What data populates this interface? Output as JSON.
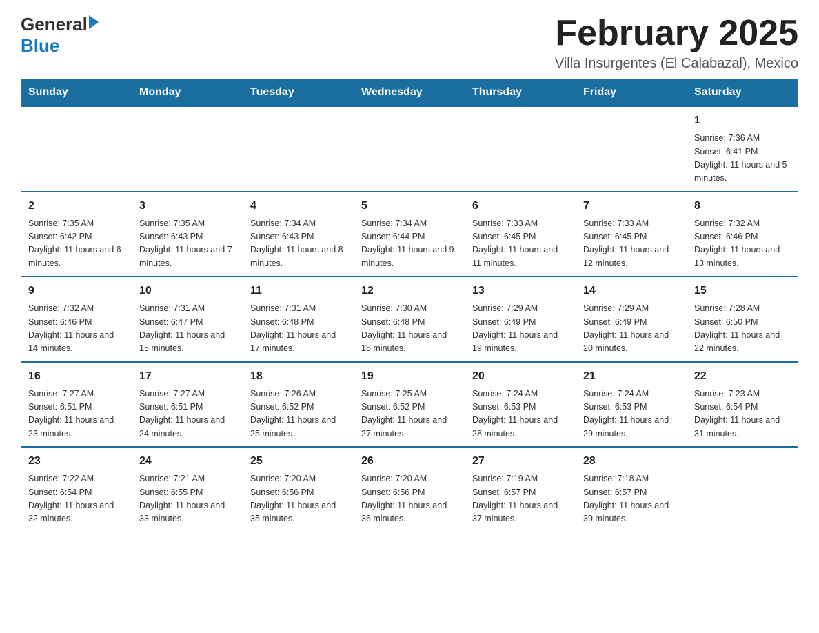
{
  "header": {
    "logo_general": "General",
    "logo_blue": "Blue",
    "title": "February 2025",
    "subtitle": "Villa Insurgentes (El Calabazal), Mexico"
  },
  "weekdays": [
    "Sunday",
    "Monday",
    "Tuesday",
    "Wednesday",
    "Thursday",
    "Friday",
    "Saturday"
  ],
  "weeks": [
    [
      {
        "day": "",
        "info": ""
      },
      {
        "day": "",
        "info": ""
      },
      {
        "day": "",
        "info": ""
      },
      {
        "day": "",
        "info": ""
      },
      {
        "day": "",
        "info": ""
      },
      {
        "day": "",
        "info": ""
      },
      {
        "day": "1",
        "info": "Sunrise: 7:36 AM\nSunset: 6:41 PM\nDaylight: 11 hours and 5 minutes."
      }
    ],
    [
      {
        "day": "2",
        "info": "Sunrise: 7:35 AM\nSunset: 6:42 PM\nDaylight: 11 hours and 6 minutes."
      },
      {
        "day": "3",
        "info": "Sunrise: 7:35 AM\nSunset: 6:43 PM\nDaylight: 11 hours and 7 minutes."
      },
      {
        "day": "4",
        "info": "Sunrise: 7:34 AM\nSunset: 6:43 PM\nDaylight: 11 hours and 8 minutes."
      },
      {
        "day": "5",
        "info": "Sunrise: 7:34 AM\nSunset: 6:44 PM\nDaylight: 11 hours and 9 minutes."
      },
      {
        "day": "6",
        "info": "Sunrise: 7:33 AM\nSunset: 6:45 PM\nDaylight: 11 hours and 11 minutes."
      },
      {
        "day": "7",
        "info": "Sunrise: 7:33 AM\nSunset: 6:45 PM\nDaylight: 11 hours and 12 minutes."
      },
      {
        "day": "8",
        "info": "Sunrise: 7:32 AM\nSunset: 6:46 PM\nDaylight: 11 hours and 13 minutes."
      }
    ],
    [
      {
        "day": "9",
        "info": "Sunrise: 7:32 AM\nSunset: 6:46 PM\nDaylight: 11 hours and 14 minutes."
      },
      {
        "day": "10",
        "info": "Sunrise: 7:31 AM\nSunset: 6:47 PM\nDaylight: 11 hours and 15 minutes."
      },
      {
        "day": "11",
        "info": "Sunrise: 7:31 AM\nSunset: 6:48 PM\nDaylight: 11 hours and 17 minutes."
      },
      {
        "day": "12",
        "info": "Sunrise: 7:30 AM\nSunset: 6:48 PM\nDaylight: 11 hours and 18 minutes."
      },
      {
        "day": "13",
        "info": "Sunrise: 7:29 AM\nSunset: 6:49 PM\nDaylight: 11 hours and 19 minutes."
      },
      {
        "day": "14",
        "info": "Sunrise: 7:29 AM\nSunset: 6:49 PM\nDaylight: 11 hours and 20 minutes."
      },
      {
        "day": "15",
        "info": "Sunrise: 7:28 AM\nSunset: 6:50 PM\nDaylight: 11 hours and 22 minutes."
      }
    ],
    [
      {
        "day": "16",
        "info": "Sunrise: 7:27 AM\nSunset: 6:51 PM\nDaylight: 11 hours and 23 minutes."
      },
      {
        "day": "17",
        "info": "Sunrise: 7:27 AM\nSunset: 6:51 PM\nDaylight: 11 hours and 24 minutes."
      },
      {
        "day": "18",
        "info": "Sunrise: 7:26 AM\nSunset: 6:52 PM\nDaylight: 11 hours and 25 minutes."
      },
      {
        "day": "19",
        "info": "Sunrise: 7:25 AM\nSunset: 6:52 PM\nDaylight: 11 hours and 27 minutes."
      },
      {
        "day": "20",
        "info": "Sunrise: 7:24 AM\nSunset: 6:53 PM\nDaylight: 11 hours and 28 minutes."
      },
      {
        "day": "21",
        "info": "Sunrise: 7:24 AM\nSunset: 6:53 PM\nDaylight: 11 hours and 29 minutes."
      },
      {
        "day": "22",
        "info": "Sunrise: 7:23 AM\nSunset: 6:54 PM\nDaylight: 11 hours and 31 minutes."
      }
    ],
    [
      {
        "day": "23",
        "info": "Sunrise: 7:22 AM\nSunset: 6:54 PM\nDaylight: 11 hours and 32 minutes."
      },
      {
        "day": "24",
        "info": "Sunrise: 7:21 AM\nSunset: 6:55 PM\nDaylight: 11 hours and 33 minutes."
      },
      {
        "day": "25",
        "info": "Sunrise: 7:20 AM\nSunset: 6:56 PM\nDaylight: 11 hours and 35 minutes."
      },
      {
        "day": "26",
        "info": "Sunrise: 7:20 AM\nSunset: 6:56 PM\nDaylight: 11 hours and 36 minutes."
      },
      {
        "day": "27",
        "info": "Sunrise: 7:19 AM\nSunset: 6:57 PM\nDaylight: 11 hours and 37 minutes."
      },
      {
        "day": "28",
        "info": "Sunrise: 7:18 AM\nSunset: 6:57 PM\nDaylight: 11 hours and 39 minutes."
      },
      {
        "day": "",
        "info": ""
      }
    ]
  ]
}
